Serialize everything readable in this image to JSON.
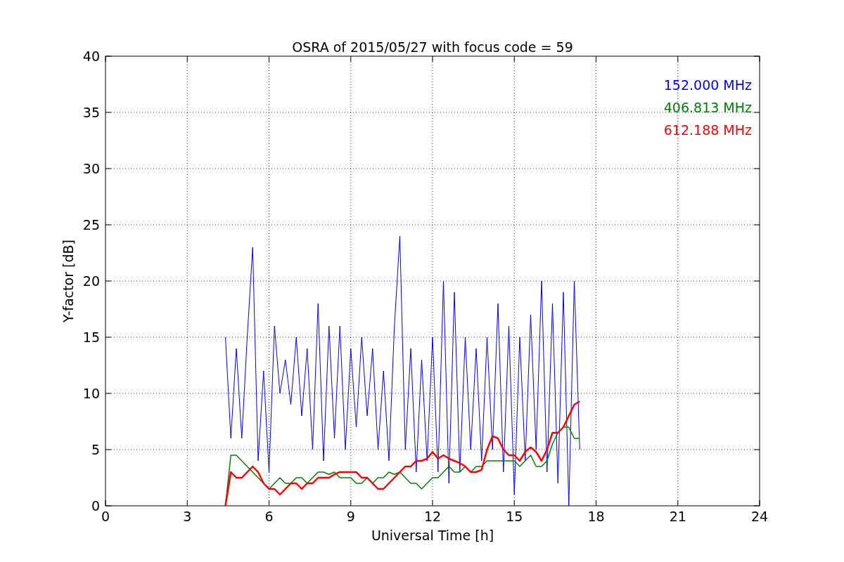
{
  "figure": {
    "chart_data": {
      "type": "line",
      "grid": true,
      "title": "OSRA of 2015/05/27 with focus code = 59",
      "xlabel": "Universal Time [h]",
      "ylabel": "Y-factor [dB]",
      "xlim": [
        0,
        24
      ],
      "ylim": [
        0,
        40
      ],
      "xticks": [
        0,
        3,
        6,
        9,
        12,
        15,
        18,
        21,
        24
      ],
      "yticks": [
        0,
        5,
        10,
        15,
        20,
        25,
        30,
        35,
        40
      ],
      "x": [
        4.4,
        4.6,
        4.8,
        5.0,
        5.2,
        5.4,
        5.6,
        5.8,
        6.0,
        6.2,
        6.4,
        6.6,
        6.8,
        7.0,
        7.2,
        7.4,
        7.6,
        7.8,
        8.0,
        8.2,
        8.4,
        8.6,
        8.8,
        9.0,
        9.2,
        9.4,
        9.6,
        9.8,
        10.0,
        10.2,
        10.4,
        10.6,
        10.8,
        11.0,
        11.2,
        11.4,
        11.6,
        11.8,
        12.0,
        12.2,
        12.4,
        12.6,
        12.8,
        13.0,
        13.2,
        13.4,
        13.6,
        13.8,
        14.0,
        14.2,
        14.4,
        14.6,
        14.8,
        15.0,
        15.2,
        15.4,
        15.6,
        15.8,
        16.0,
        16.2,
        16.4,
        16.6,
        16.8,
        17.0,
        17.2,
        17.4
      ],
      "series": [
        {
          "name": "152.000 MHz",
          "color": "#0000ff",
          "values": [
            15,
            6,
            14,
            6,
            15,
            23,
            4,
            12,
            3,
            16,
            10,
            13,
            9,
            15,
            8,
            14,
            5,
            18,
            4,
            16,
            6,
            16,
            5,
            14,
            7,
            15,
            8,
            14,
            5,
            12,
            4,
            16,
            24,
            5,
            14,
            3,
            13,
            4,
            15,
            3,
            20,
            2,
            19,
            3,
            15,
            5,
            14,
            4,
            15,
            5,
            18,
            3,
            16,
            1,
            15,
            4,
            17,
            5,
            20,
            3,
            18,
            2,
            19,
            0,
            20,
            5
          ]
        },
        {
          "name": "406.813 MHz",
          "color": "#008000",
          "values": [
            0,
            4.5,
            4.5,
            4,
            3.5,
            3,
            2.5,
            2,
            1.5,
            2,
            2.5,
            2,
            2,
            2.5,
            2.5,
            2,
            2.5,
            3,
            3,
            2.8,
            3,
            2.5,
            2.5,
            2.5,
            2,
            2,
            2.5,
            2,
            2.5,
            2.5,
            3,
            2.8,
            3,
            2.5,
            2,
            2,
            1.5,
            2,
            2.5,
            2.5,
            3,
            3.5,
            3,
            3,
            3.5,
            3,
            3.5,
            3.5,
            4,
            4,
            4,
            4,
            4,
            4,
            3.5,
            4,
            4.5,
            3.5,
            3.5,
            4,
            5.5,
            6.5,
            7,
            7,
            6,
            6
          ]
        },
        {
          "name": "612.188 MHz",
          "color": "#ff0000",
          "values": [
            0,
            3,
            2.5,
            2.5,
            3,
            3.5,
            3,
            2,
            1.5,
            1.5,
            1,
            1.5,
            2,
            2,
            1.5,
            2,
            2,
            2.5,
            2.5,
            2.5,
            2.8,
            3,
            3,
            3,
            3,
            2.5,
            2.5,
            2,
            1.5,
            1.5,
            2,
            2.5,
            3,
            3.5,
            3.5,
            4,
            4,
            4.2,
            4.8,
            4.2,
            4.5,
            4.2,
            4,
            3.8,
            3.5,
            3,
            3,
            3.2,
            5,
            6.2,
            6,
            5,
            4.5,
            4.5,
            4,
            4.8,
            5.2,
            4.8,
            4,
            5,
            6.5,
            6.5,
            7,
            8,
            9,
            9.3
          ]
        }
      ]
    }
  }
}
